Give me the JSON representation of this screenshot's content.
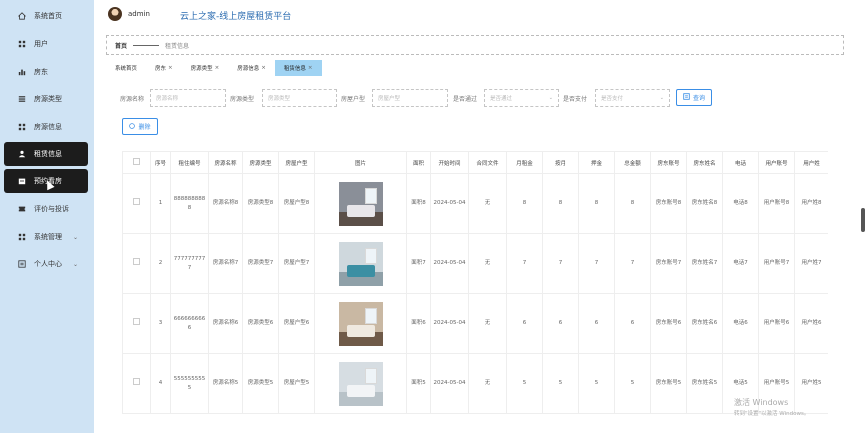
{
  "header": {
    "username": "admin",
    "title": "云上之家-线上房屋租赁平台"
  },
  "sidebar": {
    "items": [
      {
        "label": "系统首页",
        "icon": "home-icon"
      },
      {
        "label": "用户",
        "icon": "grid-icon"
      },
      {
        "label": "房东",
        "icon": "bar-chart-icon"
      },
      {
        "label": "房源类型",
        "icon": "list-icon"
      },
      {
        "label": "房源信息",
        "icon": "grid-icon"
      },
      {
        "label": "租赁信息",
        "icon": "user-icon",
        "active": true
      },
      {
        "label": "预约看房",
        "icon": "calendar-icon",
        "active": true
      },
      {
        "label": "评价与投诉",
        "icon": "ticket-icon"
      },
      {
        "label": "系统管理",
        "icon": "grid-icon",
        "expandable": true
      },
      {
        "label": "个人中心",
        "icon": "profile-icon",
        "expandable": true
      }
    ]
  },
  "breadcrumb": {
    "home": "首页",
    "current": "租赁信息"
  },
  "tabs": [
    {
      "label": "系统首页",
      "closable": false
    },
    {
      "label": "房东",
      "closable": true
    },
    {
      "label": "房源类型",
      "closable": true
    },
    {
      "label": "房源信息",
      "closable": true
    },
    {
      "label": "租赁信息",
      "closable": true,
      "active": true
    }
  ],
  "filters": [
    {
      "label": "房源名称",
      "placeholder": "房源名称"
    },
    {
      "label": "房源类型",
      "placeholder": "房源类型"
    },
    {
      "label": "房屋户型",
      "placeholder": "房屋户型"
    },
    {
      "label": "是否通过",
      "placeholder": "是否通过",
      "dropdown": true
    },
    {
      "label": "是否支付",
      "placeholder": "是否支付",
      "dropdown": true
    }
  ],
  "buttons": {
    "query": "查询",
    "delete": "删除"
  },
  "table": {
    "columns": [
      "",
      "序号",
      "租住编号",
      "房源名称",
      "房源类型",
      "房屋户型",
      "图片",
      "面积",
      "开始时间",
      "合同文件",
      "月租金",
      "按月",
      "押金",
      "总金额",
      "房东账号",
      "房东姓名",
      "电话",
      "用户账号",
      "用户姓"
    ],
    "rows": [
      [
        "",
        "1",
        "8888888888",
        "房源名称8",
        "房源类型8",
        "房屋户型8",
        "",
        "面积8",
        "2024-05-04",
        "无",
        "8",
        "8",
        "8",
        "8",
        "房东账号8",
        "房东姓名8",
        "电话8",
        "用户账号8",
        "用户姓8"
      ],
      [
        "",
        "2",
        "7777777777",
        "房源名称7",
        "房源类型7",
        "房屋户型7",
        "",
        "面积7",
        "2024-05-04",
        "无",
        "7",
        "7",
        "7",
        "7",
        "房东账号7",
        "房东姓名7",
        "电话7",
        "用户账号7",
        "用户姓7"
      ],
      [
        "",
        "3",
        "6666666666",
        "房源名称6",
        "房源类型6",
        "房屋户型6",
        "",
        "面积6",
        "2024-05-04",
        "无",
        "6",
        "6",
        "6",
        "6",
        "房东账号6",
        "房东姓名6",
        "电话6",
        "用户账号6",
        "用户姓6"
      ],
      [
        "",
        "4",
        "5555555555",
        "房源名称5",
        "房源类型5",
        "房屋户型5",
        "",
        "面积5",
        "2024-05-04",
        "无",
        "5",
        "5",
        "5",
        "5",
        "房东账号5",
        "房东姓名5",
        "电话5",
        "用户账号5",
        "用户姓5"
      ]
    ],
    "thumb_colors": [
      {
        "wall": "#8a8f98",
        "floor": "#5b4f48",
        "furn": "#e8e6ea"
      },
      {
        "wall": "#cfd8dd",
        "floor": "#8fa0a8",
        "furn": "#3b8fa3"
      },
      {
        "wall": "#c9b8a3",
        "floor": "#6f5a48",
        "furn": "#efe9e0"
      },
      {
        "wall": "#d6dde2",
        "floor": "#b8c2c8",
        "furn": "#f2f4f6"
      }
    ]
  },
  "watermark": {
    "line1": "激活 Windows",
    "line2": "转到\"设置\"以激活 Windows。"
  }
}
